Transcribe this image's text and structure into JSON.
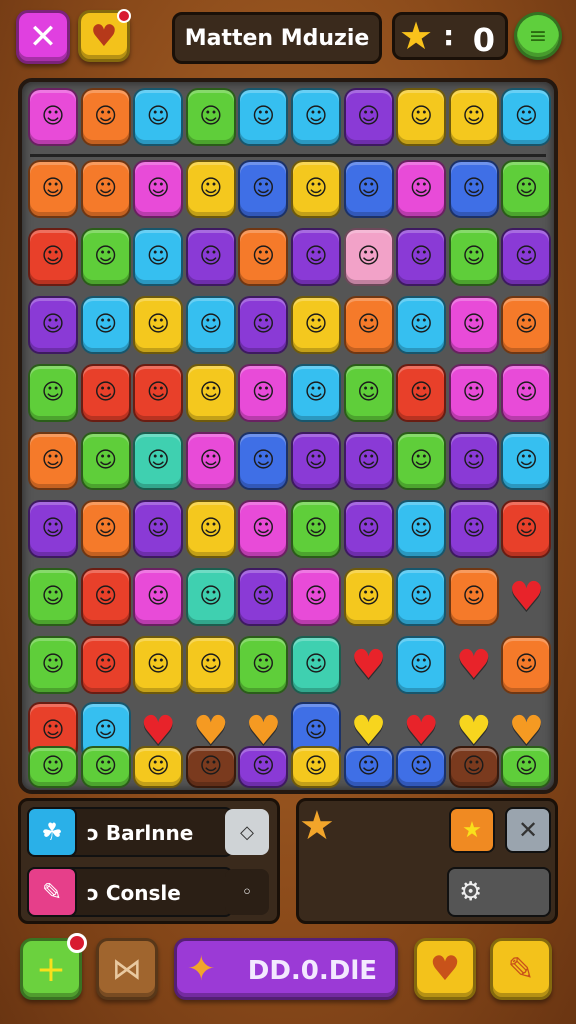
{
  "header": {
    "title": "Matten Mduzie",
    "score_colon": ":",
    "score": "0",
    "close_glyph": "✕",
    "fav_glyph": "♥",
    "menu_glyph": "≡",
    "star_glyph": "★"
  },
  "palette": {
    "pink": "#e84bd8",
    "orange": "#f57a2a",
    "cyan": "#36bff0",
    "green": "#5fce3a",
    "yellow": "#f4c81e",
    "purple": "#8a3ad6",
    "red": "#e8402a",
    "blue": "#3f6fe6",
    "teal": "#3fd0b0",
    "brown": "#7a3a1e",
    "light_pink": "#f2a2c8",
    "heart_red": "#e8232a",
    "heart_orange": "#f59a22",
    "heart_yellow": "#f7d51e"
  },
  "board": {
    "rows": [
      [
        "pink",
        "orange",
        "cyan",
        "green",
        "cyan",
        "cyan",
        "purple",
        "yellow",
        "yellow",
        "cyan"
      ],
      [
        "orange",
        "orange",
        "pink",
        "yellow",
        "blue",
        "yellow",
        "blue",
        "pink",
        "blue",
        "green"
      ],
      [
        "red",
        "green",
        "cyan",
        "purple",
        "orange",
        "purple",
        "light_pink",
        "purple",
        "green",
        "purple"
      ],
      [
        "purple",
        "cyan",
        "yellow",
        "cyan",
        "purple",
        "yellow",
        "orange",
        "cyan",
        "pink",
        "orange"
      ],
      [
        "green",
        "red",
        "red",
        "yellow",
        "pink",
        "cyan",
        "green",
        "red",
        "pink",
        "pink"
      ],
      [
        "orange",
        "green",
        "teal",
        "pink",
        "blue",
        "purple",
        "purple",
        "green",
        "purple",
        "cyan"
      ],
      [
        "purple",
        "orange",
        "purple",
        "yellow",
        "pink",
        "green",
        "purple",
        "cyan",
        "purple",
        "red"
      ],
      [
        "green",
        "red",
        "pink",
        "teal",
        "purple",
        "pink",
        "yellow",
        "cyan",
        "orange",
        "heart_red"
      ],
      [
        "green",
        "red",
        "yellow",
        "yellow",
        "green",
        "teal",
        "heart_red",
        "cyan",
        "heart_red",
        "orange"
      ],
      [
        "red",
        "cyan",
        "heart_red",
        "heart_orange",
        "heart_orange",
        "blue",
        "heart_yellow",
        "heart_red",
        "heart_yellow",
        "heart_orange"
      ],
      [
        "green",
        "green",
        "yellow",
        "brown",
        "purple",
        "yellow",
        "blue",
        "blue",
        "brown",
        "green"
      ]
    ],
    "face_glyph": "☺",
    "heart_glyph": "♥"
  },
  "panel_left": {
    "items": [
      {
        "label": "ↄ Barlnne",
        "icon_color": "#2ab0e8",
        "icon_glyph": "☘",
        "end_glyph": "◇",
        "end_color": "#cfd3d6"
      },
      {
        "label": "ↄ Consle",
        "icon_color": "#e63f8a",
        "icon_glyph": "✎",
        "end_glyph": "◦",
        "end_color": "#2b1f15"
      }
    ]
  },
  "panel_right": {
    "star_glyph": "★",
    "bonus_glyph": "★",
    "x2_glyph": "✕",
    "gear_glyph": "⚙"
  },
  "bottom": {
    "add_glyph": "+",
    "bow_glyph": "⋈",
    "main_icon": "✦",
    "main_label": "DD.0.DlE",
    "heart_glyph": "♥",
    "pencil_glyph": "✎"
  }
}
